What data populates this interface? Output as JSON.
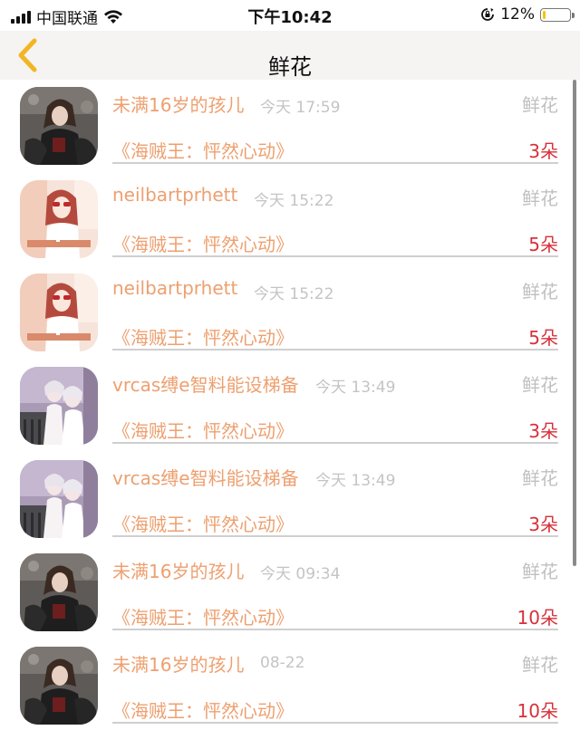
{
  "status_bar": {
    "carrier": "中国联通",
    "time": "下午10:42",
    "battery_percent": "12%",
    "battery_level": 0.12,
    "battery_color": "#f5c400"
  },
  "nav": {
    "back_icon": "chevron-left-icon",
    "title": "鲜花",
    "accent": "#f2b624"
  },
  "colors": {
    "name": "#eda070",
    "time": "#c4c4c4",
    "count": "#d8303a"
  },
  "records": [
    {
      "avatar": "dark-costume-avatar",
      "name": "未满16岁的孩儿",
      "time": "今天 17:59",
      "gift": "鲜花",
      "book": "《海贼王：怦然心动》",
      "count": "3朵"
    },
    {
      "avatar": "pink-girl-avatar",
      "name": "neilbartprhett",
      "time": "今天 15:22",
      "gift": "鲜花",
      "book": "《海贼王：怦然心动》",
      "count": "5朵"
    },
    {
      "avatar": "pink-girl-avatar",
      "name": "neilbartprhett",
      "time": "今天 15:22",
      "gift": "鲜花",
      "book": "《海贼王：怦然心动》",
      "count": "5朵"
    },
    {
      "avatar": "two-girls-avatar",
      "name": "vrcas缚e智料能设梯备",
      "time": "今天 13:49",
      "gift": "鲜花",
      "book": "《海贼王：怦然心动》",
      "count": "3朵"
    },
    {
      "avatar": "two-girls-avatar",
      "name": "vrcas缚e智料能设梯备",
      "time": "今天 13:49",
      "gift": "鲜花",
      "book": "《海贼王：怦然心动》",
      "count": "3朵"
    },
    {
      "avatar": "dark-costume-avatar",
      "name": "未满16岁的孩儿",
      "time": "今天 09:34",
      "gift": "鲜花",
      "book": "《海贼王：怦然心动》",
      "count": "10朵"
    },
    {
      "avatar": "dark-costume-avatar",
      "name": "未满16岁的孩儿",
      "time": "08-22",
      "gift": "鲜花",
      "book": "《海贼王：怦然心动》",
      "count": "10朵"
    }
  ]
}
